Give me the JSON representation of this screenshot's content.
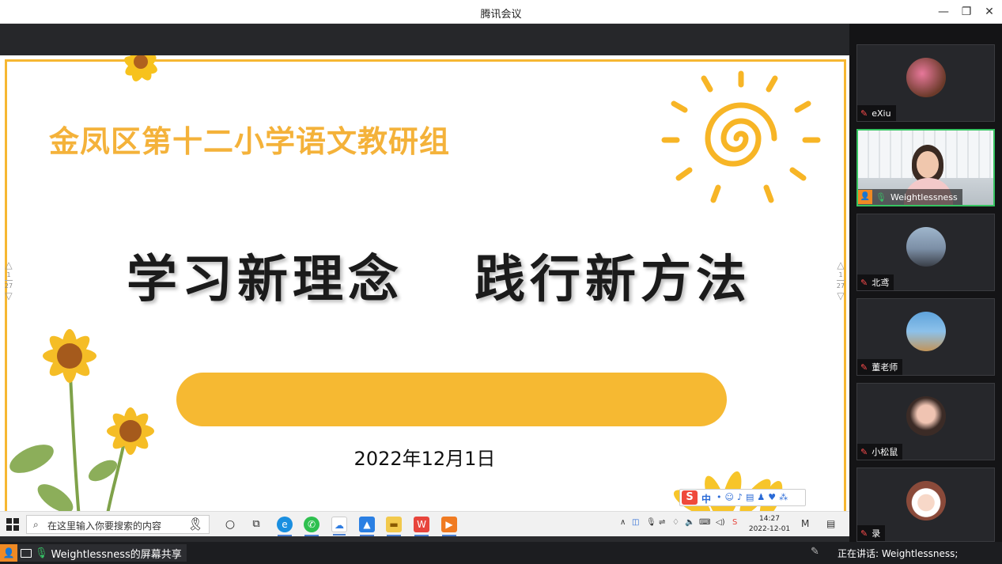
{
  "window": {
    "title": "腾讯会议",
    "minimize_icon": "minimize-icon",
    "restore_icon": "restore-icon",
    "close_icon": "close-icon"
  },
  "slide": {
    "group_title": "金凤区第十二小学语文教研组",
    "main_left": "学习新理念",
    "main_right": "践行新方法",
    "date": "2022年12月1日",
    "page_current": "1",
    "page_total": "27",
    "accent_color": "#f6b732"
  },
  "taskbar": {
    "search_placeholder": "在这里输入你要搜索的内容",
    "clock_time": "14:27",
    "clock_date": "2022-12-01",
    "ime_zh": "中"
  },
  "participants": [
    {
      "name": "eXiu",
      "mic": "off"
    },
    {
      "name": "Weightlessness",
      "mic": "on",
      "active": true
    },
    {
      "name": "北鸢",
      "mic": "off"
    },
    {
      "name": "董老师",
      "mic": "off"
    },
    {
      "name": "小松鼠",
      "mic": "off"
    },
    {
      "name": "录",
      "mic": "off"
    }
  ],
  "bottom": {
    "share_label": "Weightlessness的屏幕共享",
    "speaking_label": "正在讲话: Weightlessness;"
  }
}
